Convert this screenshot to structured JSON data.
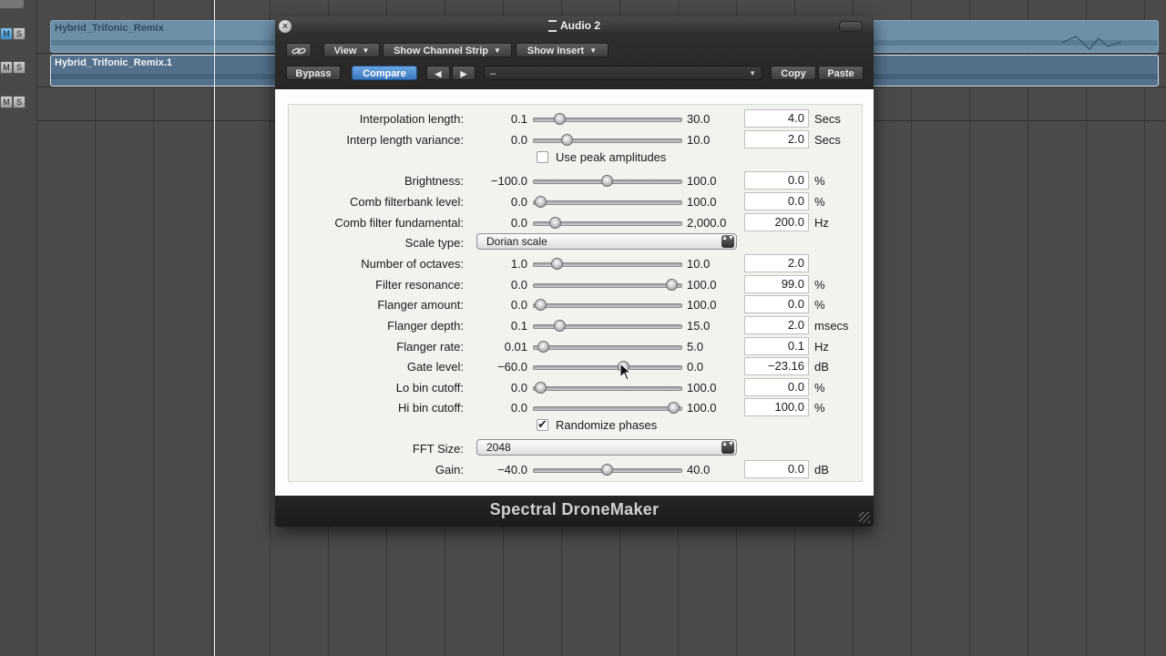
{
  "tracks": {
    "rows": [
      {
        "m": "M",
        "s": "S",
        "m_active": true
      },
      {
        "m": "M",
        "s": "S",
        "m_active": false
      },
      {
        "m": "M",
        "s": "S",
        "m_active": false
      }
    ],
    "regions": [
      {
        "name": "Hybrid_Trifonic_Remix",
        "icon": "loop-icon"
      },
      {
        "name": "Hybrid_Trifonic_Remix.1",
        "icon": "loop-icon"
      }
    ]
  },
  "plugin_window": {
    "title": "Audio 2",
    "close_glyph": "×",
    "toolbar": {
      "link_icon": "link-icon",
      "view_label": "View",
      "channel_strip_label": "Show Channel Strip",
      "insert_label": "Show Insert",
      "bypass_label": "Bypass",
      "compare_label": "Compare",
      "prev_glyph": "◀",
      "next_glyph": "▶",
      "preset_value": "–",
      "copy_label": "Copy",
      "paste_label": "Paste",
      "dropdown_glyph": "▼"
    },
    "params": {
      "interpolation_length": {
        "label": "Interpolation length:",
        "min": "0.1",
        "max": "30.0",
        "value": "4.0",
        "unit": "Secs",
        "position": 0.18
      },
      "interp_length_variance": {
        "label": "Interp length variance:",
        "min": "0.0",
        "max": "10.0",
        "value": "2.0",
        "unit": "Secs",
        "position": 0.23
      },
      "use_peak_amplitudes": {
        "label": "Use peak amplitudes",
        "checked": false
      },
      "brightness": {
        "label": "Brightness:",
        "min": "−100.0",
        "max": "100.0",
        "value": "0.0",
        "unit": "%",
        "position": 0.5
      },
      "comb_filterbank_level": {
        "label": "Comb filterbank level:",
        "min": "0.0",
        "max": "100.0",
        "value": "0.0",
        "unit": "%",
        "position": 0.05
      },
      "comb_filter_fundamental": {
        "label": "Comb filter fundamental:",
        "min": "0.0",
        "max": "2,000.0",
        "value": "200.0",
        "unit": "Hz",
        "position": 0.15
      },
      "scale_type": {
        "label": "Scale type:",
        "value": "Dorian scale"
      },
      "number_of_octaves": {
        "label": "Number of octaves:",
        "min": "1.0",
        "max": "10.0",
        "value": "2.0",
        "unit": "",
        "position": 0.16
      },
      "filter_resonance": {
        "label": "Filter resonance:",
        "min": "0.0",
        "max": "100.0",
        "value": "99.0",
        "unit": "%",
        "position": 0.94
      },
      "flanger_amount": {
        "label": "Flanger amount:",
        "min": "0.0",
        "max": "100.0",
        "value": "0.0",
        "unit": "%",
        "position": 0.05
      },
      "flanger_depth": {
        "label": "Flanger depth:",
        "min": "0.1",
        "max": "15.0",
        "value": "2.0",
        "unit": "msecs",
        "position": 0.18
      },
      "flanger_rate": {
        "label": "Flanger rate:",
        "min": "0.01",
        "max": "5.0",
        "value": "0.1",
        "unit": "Hz",
        "position": 0.07
      },
      "gate_level": {
        "label": "Gate level:",
        "min": "−60.0",
        "max": "0.0",
        "value": "−23.16",
        "unit": "dB",
        "position": 0.61
      },
      "lo_bin_cutoff": {
        "label": "Lo bin cutoff:",
        "min": "0.0",
        "max": "100.0",
        "value": "0.0",
        "unit": "%",
        "position": 0.05
      },
      "hi_bin_cutoff": {
        "label": "Hi bin cutoff:",
        "min": "0.0",
        "max": "100.0",
        "value": "100.0",
        "unit": "%",
        "position": 0.95
      },
      "randomize_phases": {
        "label": "Randomize phases",
        "checked": true,
        "check_glyph": "✔"
      },
      "fft_size": {
        "label": "FFT Size:",
        "value": "2048"
      },
      "gain": {
        "label": "Gain:",
        "min": "−40.0",
        "max": "40.0",
        "value": "0.0",
        "unit": "dB",
        "position": 0.5
      }
    },
    "dropdown_arrows": "▲▼",
    "brand": "Spectral DroneMaker"
  }
}
